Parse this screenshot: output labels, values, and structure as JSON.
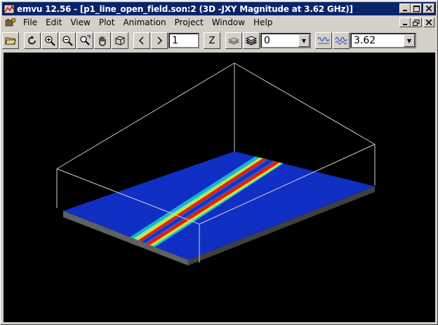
{
  "window": {
    "title": "emvu 12.56 - [p1_line_open_field.son:2 (3D -JXY Magnitude at 3.62 GHz)]"
  },
  "menu": {
    "items": [
      "File",
      "Edit",
      "View",
      "Plot",
      "Animation",
      "Project",
      "Window",
      "Help"
    ]
  },
  "toolbar": {
    "frame_value": "1",
    "z_label": "Z",
    "level_value": "0",
    "frequency_value": "3.62"
  },
  "colors": {
    "title_bar": "#0a246a",
    "canvas_bg": "#000000",
    "plane_blue": "#1030c8",
    "current_red": "#e02010",
    "box_lines": "#c0c0c0"
  },
  "icons": [
    "app-icon",
    "doc-icon",
    "open-folder-icon",
    "rotate-icon",
    "zoom-in-icon",
    "zoom-out-icon",
    "zoom-box-icon",
    "pan-hand-icon",
    "cube-view-icon",
    "prev-icon",
    "next-icon",
    "z-axis-icon",
    "layers-icon",
    "stack-icon",
    "wave-icon",
    "wave-alt-icon"
  ]
}
